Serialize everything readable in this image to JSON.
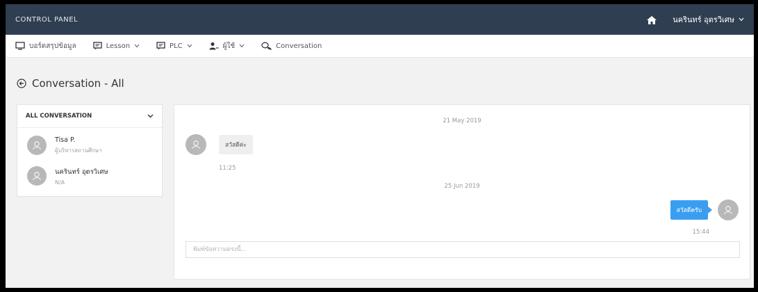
{
  "header": {
    "logo_text": "CONTROL PANEL",
    "user_name": "นครินทร์ อุตรวิเศษ"
  },
  "nav": {
    "items": [
      {
        "label": "บอร์ดสรุปข้อมูล",
        "icon": "monitor-icon",
        "has_dropdown": false
      },
      {
        "label": "Lesson",
        "icon": "message-square-icon",
        "has_dropdown": true
      },
      {
        "label": "PLC",
        "icon": "message-square-icon",
        "has_dropdown": true
      },
      {
        "label": "ผู้ใช้",
        "icon": "user-icon",
        "has_dropdown": true
      },
      {
        "label": "Conversation",
        "icon": "chat-bubbles-icon",
        "has_dropdown": false
      }
    ]
  },
  "page": {
    "title": "Conversation - All"
  },
  "sidebar": {
    "dropdown_label": "ALL CONVERSATION",
    "contacts": [
      {
        "name": "Tisa P.",
        "role": "ผู้บริหารสถานศึกษา"
      },
      {
        "name": "นครินทร์ อุตรวิเศษ",
        "role": "N/A"
      }
    ]
  },
  "chat": {
    "date_1": "21 May 2019",
    "msg_1_text": "สวัสดีค่ะ",
    "msg_1_time": "11:25",
    "date_2": "25 Jun 2019",
    "msg_2_text": "สวัสดีครับ",
    "msg_2_time": "15:44",
    "input_placeholder": "พิมพ์ข้อความตรงนี้...",
    "input_value": ""
  },
  "colors": {
    "header_bg": "#2f3e50",
    "outgoing_bubble": "#3a9ef0",
    "incoming_bubble": "#efefef",
    "avatar": "#b8b8b8"
  }
}
